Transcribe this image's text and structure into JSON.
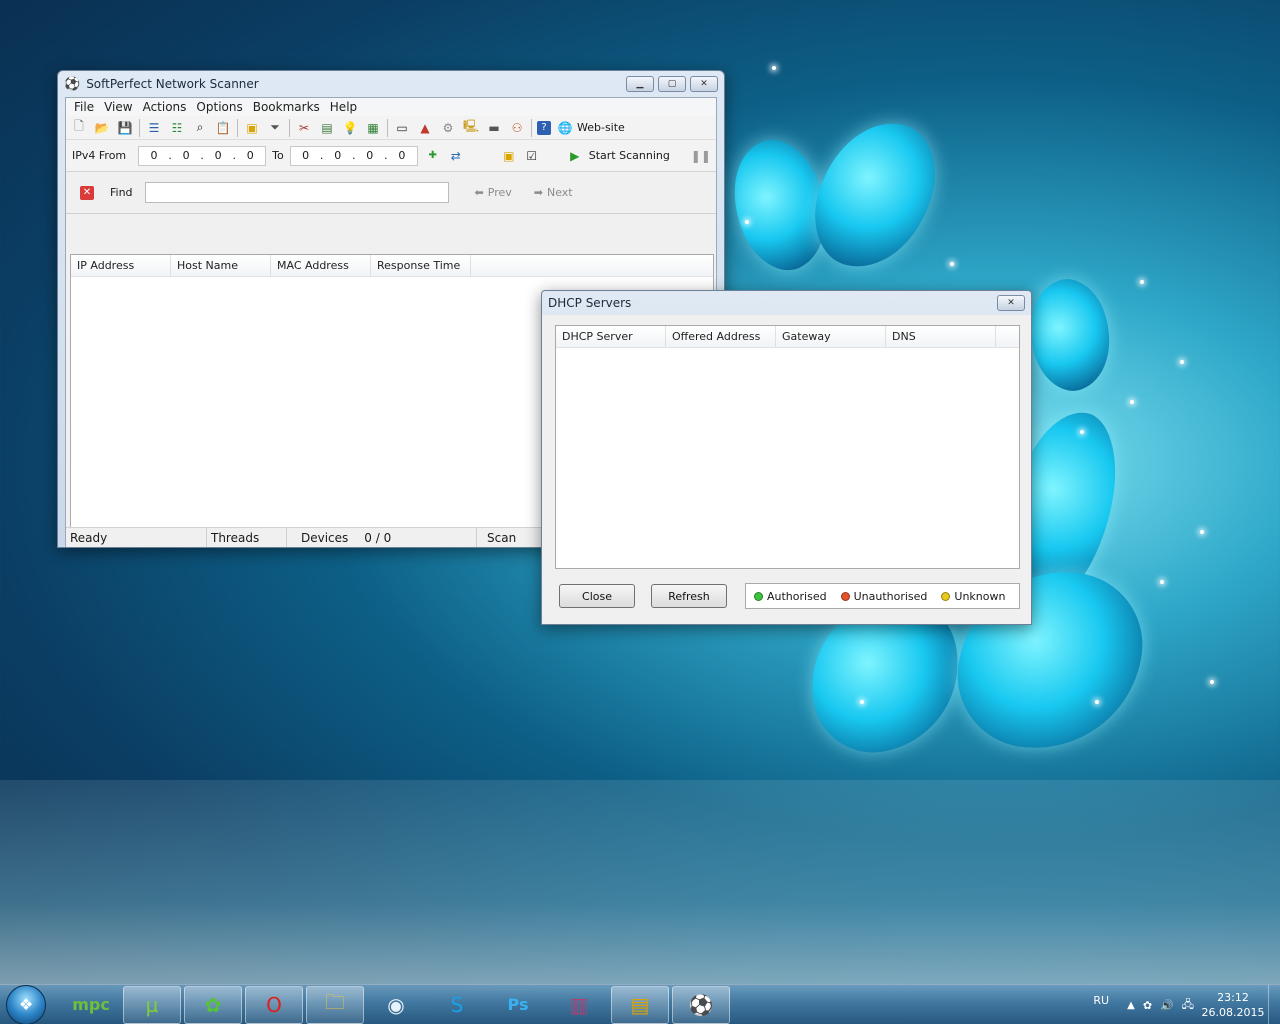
{
  "scanner": {
    "title": "SoftPerfect Network Scanner",
    "menu": [
      "File",
      "View",
      "Actions",
      "Options",
      "Bookmarks",
      "Help"
    ],
    "website_label": "Web-site",
    "ipv4_from_label": "IPv4 From",
    "from_ip": [
      "0",
      "0",
      "0",
      "0"
    ],
    "to_label": "To",
    "to_ip": [
      "0",
      "0",
      "0",
      "0"
    ],
    "start_label": "Start Scanning",
    "find_label": "Find",
    "find_value": "",
    "prev_label": "Prev",
    "next_label": "Next",
    "columns": [
      "IP Address",
      "Host Name",
      "MAC Address",
      "Response Time"
    ],
    "status": {
      "ready": "Ready",
      "threads": "Threads",
      "devices_label": "Devices",
      "devices_value": "0 / 0",
      "scan": "Scan"
    }
  },
  "dhcp": {
    "title": "DHCP Servers",
    "columns": [
      "DHCP Server",
      "Offered Address",
      "Gateway",
      "DNS"
    ],
    "close_label": "Close",
    "refresh_label": "Refresh",
    "legend": [
      {
        "label": "Authorised",
        "color": "#3cc43c"
      },
      {
        "label": "Unauthorised",
        "color": "#e2532b"
      },
      {
        "label": "Unknown",
        "color": "#e7c81c"
      }
    ]
  },
  "taskbar": {
    "lang": "RU",
    "time": "23:12",
    "date": "26.08.2015",
    "apps": [
      "mpc-icon",
      "utorrent-icon",
      "icq-icon",
      "opera-icon",
      "explorer-icon",
      "camera-icon",
      "skype-icon",
      "photoshop-icon",
      "winrar-icon",
      "archive-icon",
      "network-scanner-icon"
    ]
  }
}
